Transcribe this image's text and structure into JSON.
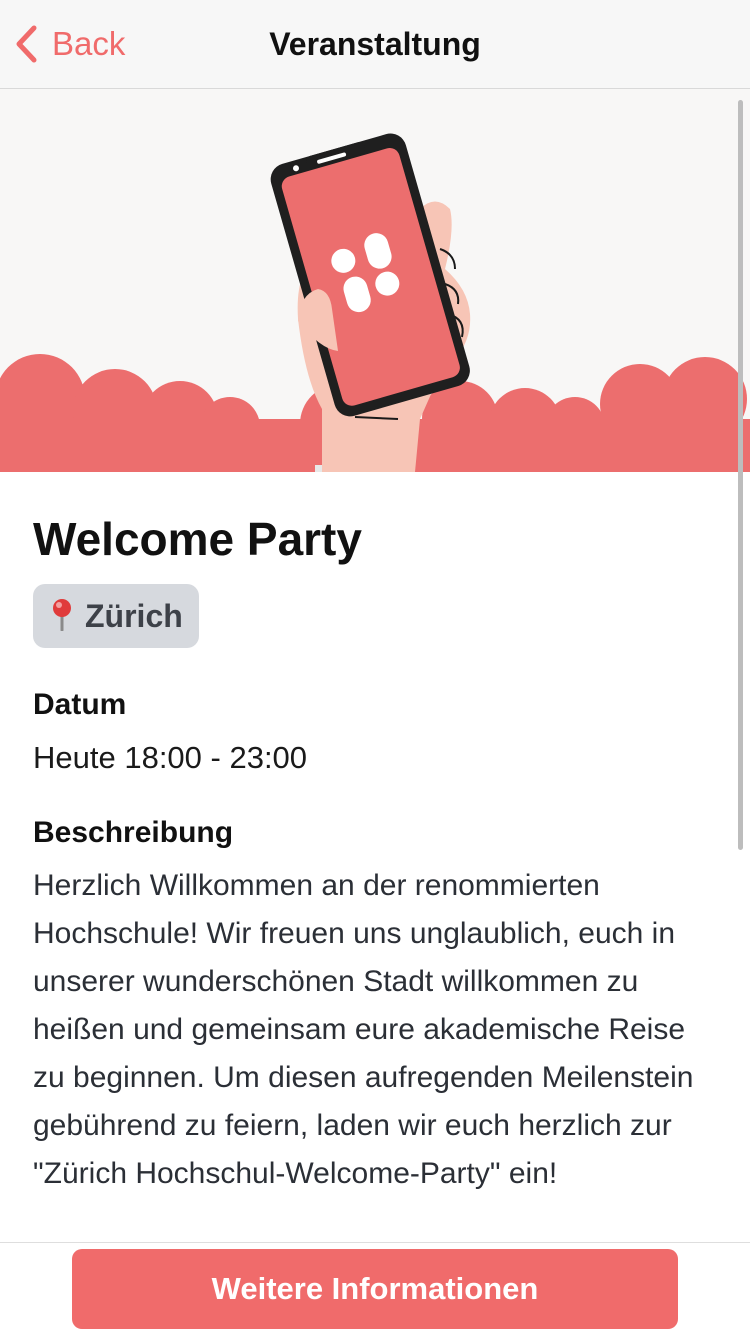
{
  "nav": {
    "back_label": "Back",
    "title": "Veranstaltung"
  },
  "hero": {
    "illustration": "hand-holding-phone-with-app-logo",
    "accent_color": "#ec6e6e"
  },
  "event": {
    "title": "Welcome Party",
    "location": "Zürich",
    "location_icon": "pin-icon",
    "date_label": "Datum",
    "date_value": "Heute 18:00 - 23:00",
    "description_label": "Beschreibung",
    "description": "Herzlich Willkommen an der renommierten Hochschule! Wir freuen uns unglaublich, euch in unserer wunderschönen Stadt willkommen zu heißen und gemeinsam eure akademische Reise zu beginnen. Um diesen aufregenden Meilenstein gebührend zu feiern, laden wir euch herzlich zur \"Zürich Hochschul-Welcome-Party\" ein!"
  },
  "actions": {
    "more_info_label": "Weitere Informationen"
  },
  "colors": {
    "accent": "#f06b6b",
    "chip_bg": "#d6d9de",
    "navbar_bg": "#f7f7f7"
  }
}
